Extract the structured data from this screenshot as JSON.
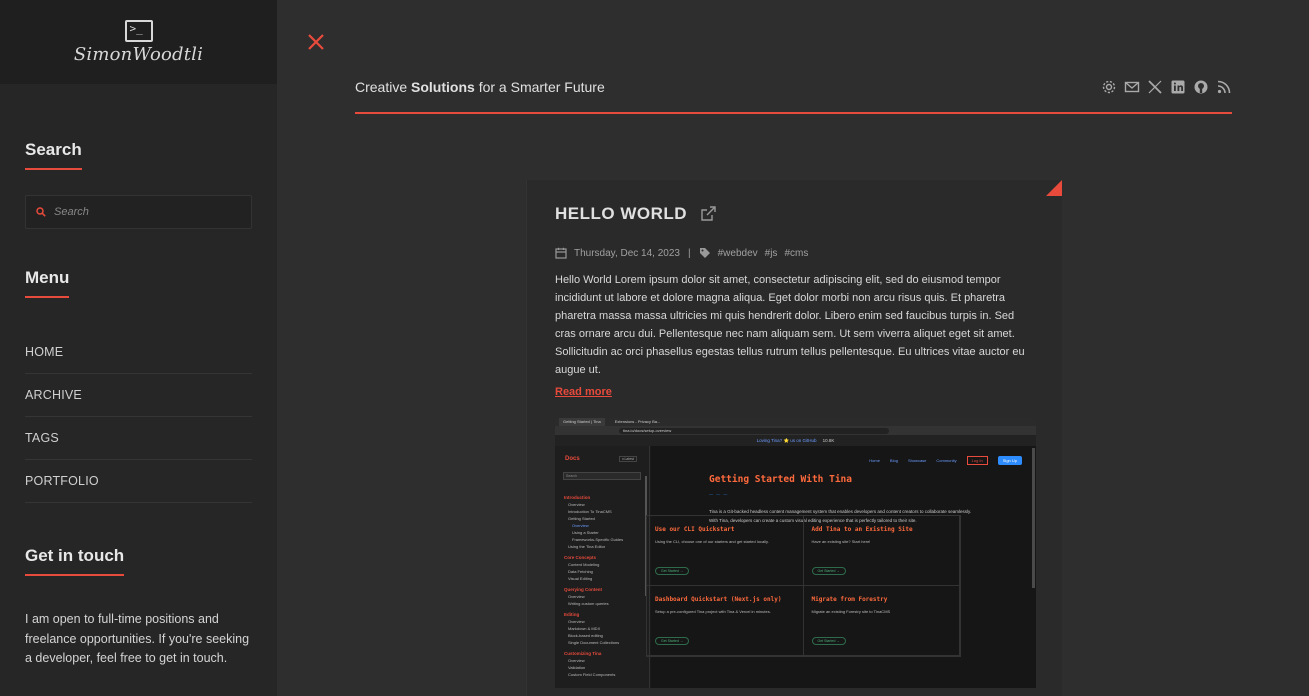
{
  "logo": {
    "prompt_glyph": ">_",
    "text": "SimonWoodtli"
  },
  "sidebar": {
    "search_heading": "Search",
    "search_placeholder": "Search",
    "menu_heading": "Menu",
    "menu_items": [
      "HOME",
      "ARCHIVE",
      "TAGS",
      "PORTFOLIO"
    ],
    "touch_heading": "Get in touch",
    "touch_text": "I am open to full-time positions and freelance opportunities. If you're seeking a developer, feel free to get in touch."
  },
  "header": {
    "tagline_pre": "Creative ",
    "tagline_bold": "Solutions",
    "tagline_post": " for a Smarter Future",
    "social_icons": [
      "gear-icon",
      "mail-icon",
      "x-icon",
      "linkedin-icon",
      "github-icon",
      "rss-icon"
    ]
  },
  "post": {
    "title": "HELLO WORLD",
    "date": "Thursday, Dec 14, 2023",
    "separator": "|",
    "tags": [
      "#webdev",
      "#js",
      "#cms"
    ],
    "excerpt": "Hello World Lorem ipsum dolor sit amet, consectetur adipiscing elit, sed do eiusmod tempor incididunt ut labore et dolore magna aliqua. Eget dolor morbi non arcu risus quis. Et pharetra pharetra massa massa ultricies mi quis hendrerit dolor. Libero enim sed faucibus turpis in. Sed cras ornare arcu dui. Pellentesque nec nam aliquam sem. Ut sem viverra aliquet eget sit amet. Sollicitudin ac orci phasellus egestas tellus rutrum tellus pellentesque. Eu ultrices vitae auctor eu augue ut.",
    "read_more": "Read more"
  },
  "screenshot": {
    "tab1": "Getting Started | Tina",
    "tab2": "Extensions - Privacy Ba...",
    "url": "tina.io/docs/setup-overview",
    "banner": "Loving Tina? ⭐ us on GitHub",
    "banner_count": "10.8K",
    "docs_label": "Docs",
    "version": "v.Latest",
    "search_placeholder": "Search",
    "nav": [
      {
        "type": "h",
        "text": "Introduction"
      },
      {
        "type": "sub",
        "text": "Overview"
      },
      {
        "type": "sub",
        "text": "Introduction To TinaCMS"
      },
      {
        "type": "sub",
        "text": "Getting Started"
      },
      {
        "type": "act",
        "text": "Overview"
      },
      {
        "type": "sub2",
        "text": "Using a Starter"
      },
      {
        "type": "sub2",
        "text": "Frameworks-Specific Guides"
      },
      {
        "type": "sub",
        "text": "Using the Tina Editor"
      },
      {
        "type": "h",
        "text": "Core Concepts"
      },
      {
        "type": "sub",
        "text": "Content Modeling"
      },
      {
        "type": "sub",
        "text": "Data Fetching"
      },
      {
        "type": "sub",
        "text": "Visual Editing"
      },
      {
        "type": "h",
        "text": "Querying Content"
      },
      {
        "type": "sub",
        "text": "Overview"
      },
      {
        "type": "sub",
        "text": "Writing custom queries"
      },
      {
        "type": "h",
        "text": "Editing"
      },
      {
        "type": "sub",
        "text": "Overview"
      },
      {
        "type": "sub",
        "text": "Markdown & MDX"
      },
      {
        "type": "sub",
        "text": "Block-based editing"
      },
      {
        "type": "sub",
        "text": "Single Document Collections"
      },
      {
        "type": "h",
        "text": "Customizing Tina"
      },
      {
        "type": "sub",
        "text": "Overview"
      },
      {
        "type": "sub",
        "text": "Validation"
      },
      {
        "type": "sub",
        "text": "Custom Field Components"
      }
    ],
    "topnav": [
      "Home",
      "Blog",
      "Showcase",
      "Community"
    ],
    "login": "Log In",
    "signup": "Sign Up",
    "heading": "Getting Started With Tina",
    "intro": "Tina is a Git-backed headless content management system that enables developers and content creators to collaborate seamlessly. With Tina, developers can create a custom visual editing experience that is perfectly tailored to their site.",
    "cards": [
      {
        "title": "Use our CLI Quickstart",
        "desc": "Using the CLI, choose one of our starters and get started locally.",
        "cta": "Get Started →"
      },
      {
        "title": "Add Tina to an Existing Site",
        "desc": "Have an existing site? Start here!",
        "cta": "Get Started →"
      },
      {
        "title": "Dashboard Quickstart (Next.js only)",
        "desc": "Setup a pre-configured Tina project with Tina & Vercel in minutes.",
        "cta": "Get Started →"
      },
      {
        "title": "Migrate from Forestry",
        "desc": "Migrate an existing Forestry site to TinaCMS",
        "cta": "Get Started →"
      }
    ]
  },
  "colors": {
    "accent": "#e84a3c",
    "bg": "#2e2e2e",
    "sidebar": "#262626"
  }
}
